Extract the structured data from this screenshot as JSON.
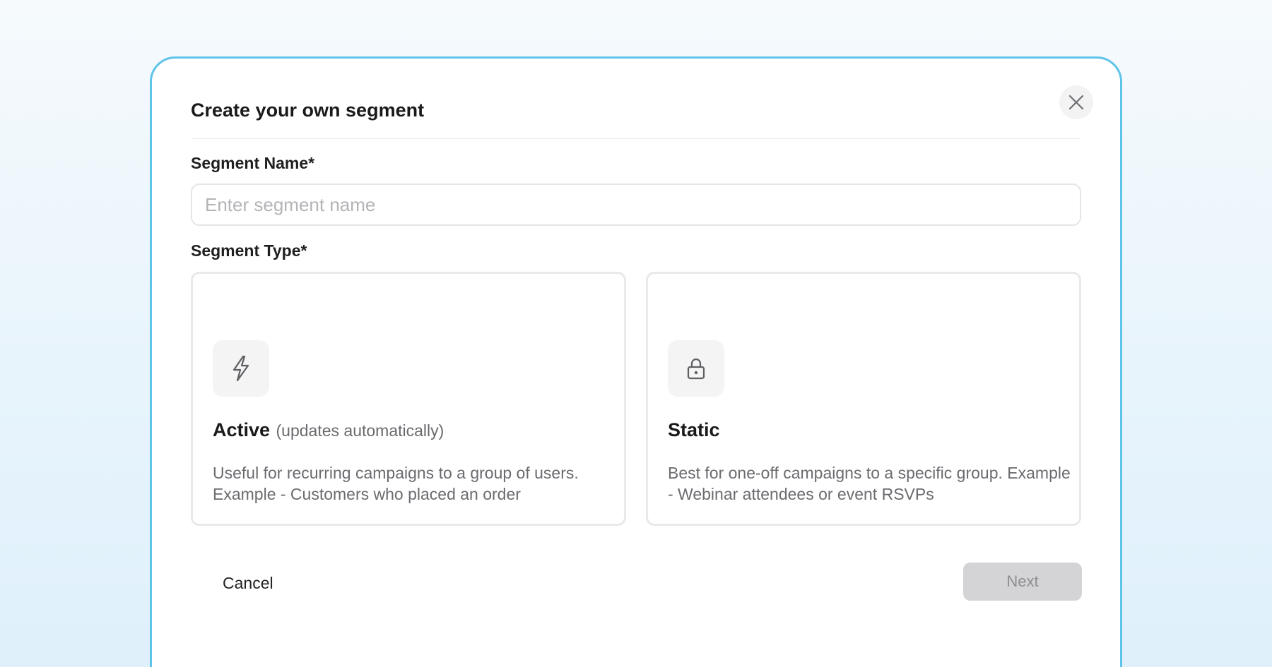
{
  "modal": {
    "title": "Create your own segment",
    "close_icon": "close-icon"
  },
  "segment_name": {
    "label": "Segment Name*",
    "value": "",
    "placeholder": "Enter segment name"
  },
  "segment_type": {
    "label": "Segment Type*",
    "options": [
      {
        "icon": "lightning-bolt-icon",
        "title": "Active",
        "subtitle": "(updates automatically)",
        "description": "Useful for recurring campaigns to a group of users. Example - Customers who placed an order"
      },
      {
        "icon": "lock-icon",
        "title": "Static",
        "subtitle": "",
        "description": "Best for one-off campaigns to a specific group. Example - Webinar attendees or event RSVPs"
      }
    ]
  },
  "footer": {
    "cancel_label": "Cancel",
    "next_label": "Next",
    "next_disabled": true
  },
  "colors": {
    "modal_border": "#5ec4ea",
    "disabled_button_bg": "#d4d4d6",
    "disabled_button_text": "#8d8d92"
  }
}
